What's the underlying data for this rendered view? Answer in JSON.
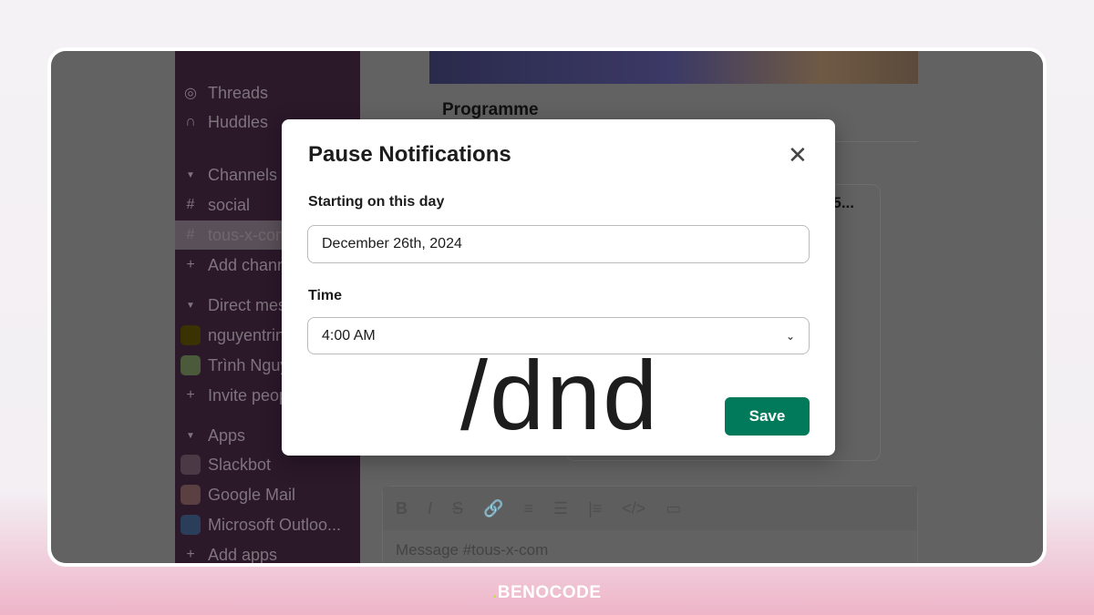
{
  "sidebar": {
    "items": [
      {
        "label": "Threads",
        "icon": "threads-icon"
      },
      {
        "label": "Huddles",
        "icon": "headphones-icon"
      },
      {
        "label": "Channels",
        "icon": "caret-down-icon"
      },
      {
        "label": "social",
        "icon": "hash-icon"
      },
      {
        "label": "tous-x-com",
        "icon": "hash-icon",
        "selected": true
      },
      {
        "label": "Add channels",
        "icon": "plus-icon"
      },
      {
        "label": "Direct messages",
        "icon": "caret-down-icon"
      },
      {
        "label": "nguyentrinh",
        "icon": "avatar"
      },
      {
        "label": "Trình Nguyễn",
        "icon": "avatar"
      },
      {
        "label": "Invite people",
        "icon": "plus-icon"
      },
      {
        "label": "Apps",
        "icon": "caret-down-icon"
      },
      {
        "label": "Slackbot",
        "icon": "slackbot-icon"
      },
      {
        "label": "Google Mail",
        "icon": "gmail-icon"
      },
      {
        "label": "Microsoft Outloo...",
        "icon": "outlook-icon"
      },
      {
        "label": "Add apps",
        "icon": "plus-icon"
      }
    ]
  },
  "main": {
    "card_title": "Programme",
    "card_snippet": "5...",
    "composer_placeholder": "Message #tous-x-com"
  },
  "modal": {
    "title": "Pause Notifications",
    "date_label": "Starting on this day",
    "date_value": "December 26th, 2024",
    "time_label": "Time",
    "time_value": "4:00 AM",
    "save_label": "Save",
    "overlay_text": "/dnd"
  },
  "branding": {
    "logo": "BENOCODE"
  },
  "colors": {
    "accent": "#007a5a",
    "sidebar": "#2b1829"
  }
}
